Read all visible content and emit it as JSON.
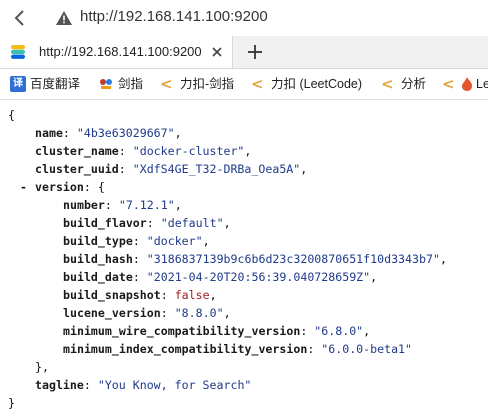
{
  "browser": {
    "address_url": "http://192.168.141.100:9200",
    "tab_title": "http://192.168.141.100:9200"
  },
  "bookmarks": [
    {
      "icon": "translate-icon",
      "label": "百度翻译"
    },
    {
      "icon": "sword-icon",
      "label": "剑指"
    },
    {
      "icon": "leetcode-icon",
      "label": "力扣-剑指"
    },
    {
      "icon": "leetcode-icon",
      "label": "力扣 (LeetCode)"
    },
    {
      "icon": "leetcode-icon",
      "label": "分析"
    },
    {
      "icon": "leetcode-icon",
      "label": "Le"
    }
  ],
  "json_view": {
    "open_brace": "{",
    "close_brace": "}",
    "toggle_symbol": "-",
    "name_key": "name",
    "name_value": "\"4b3e63029667\"",
    "cluster_name_key": "cluster_name",
    "cluster_name_value": "\"docker-cluster\"",
    "cluster_uuid_key": "cluster_uuid",
    "cluster_uuid_value": "\"XdfS4GE_T32-DRBa_Oea5A\"",
    "version_key": "version",
    "version_open": "{",
    "version_close": "},",
    "version_fields": [
      {
        "key": "number",
        "value": "\"7.12.1\"",
        "type": "string"
      },
      {
        "key": "build_flavor",
        "value": "\"default\"",
        "type": "string"
      },
      {
        "key": "build_type",
        "value": "\"docker\"",
        "type": "string"
      },
      {
        "key": "build_hash",
        "value": "\"3186837139b9c6b6d23c3200870651f10d3343b7\"",
        "type": "string"
      },
      {
        "key": "build_date",
        "value": "\"2021-04-20T20:56:39.040728659Z\"",
        "type": "string"
      },
      {
        "key": "build_snapshot",
        "value": "false",
        "type": "boolean"
      },
      {
        "key": "lucene_version",
        "value": "\"8.8.0\"",
        "type": "string"
      },
      {
        "key": "minimum_wire_compatibility_version",
        "value": "\"6.8.0\"",
        "type": "string"
      },
      {
        "key": "minimum_index_compatibility_version",
        "value": "\"6.0.0-beta1\"",
        "type": "string"
      }
    ],
    "tagline_key": "tagline",
    "tagline_value": "\"You Know, for Search\""
  }
}
